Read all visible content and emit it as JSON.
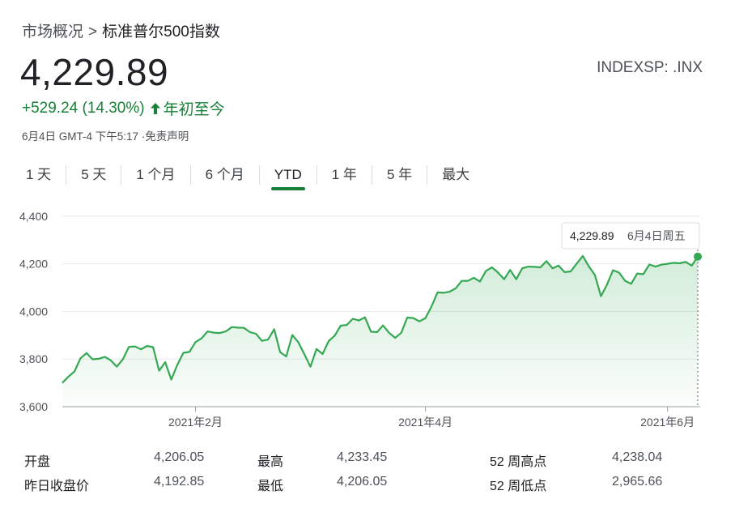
{
  "breadcrumb": {
    "parent": "市场概况",
    "separator": ">",
    "current": "标准普尔500指数"
  },
  "price": "4,229.89",
  "ticker": "INDEXSP: .INX",
  "change": {
    "text": "+529.24 (14.30%)",
    "period": "年初至今",
    "color": "#188038",
    "direction": "up",
    "icon": "arrow-up-icon"
  },
  "timestamp": "6月4日 GMT-4 下午5:17 ·免责声明",
  "tabs": [
    {
      "label": "1 天",
      "active": false
    },
    {
      "label": "5 天",
      "active": false
    },
    {
      "label": "1 个月",
      "active": false
    },
    {
      "label": "6 个月",
      "active": false
    },
    {
      "label": "YTD",
      "active": true
    },
    {
      "label": "1 年",
      "active": false
    },
    {
      "label": "5 年",
      "active": false
    },
    {
      "label": "最大",
      "active": false
    }
  ],
  "chart_data": {
    "type": "area",
    "y_ticks": [
      "4,400",
      "4,200",
      "4,000",
      "3,800",
      "3,600"
    ],
    "y_tick_values": [
      4400,
      4200,
      4000,
      3800,
      3600
    ],
    "ylim": [
      3600,
      4440
    ],
    "x_ticks": [
      {
        "label": "2021年2月",
        "index": 22
      },
      {
        "label": "2021年4月",
        "index": 60
      },
      {
        "label": "2021年6月",
        "index": 100
      }
    ],
    "line_color": "#34a853",
    "grid": true,
    "tooltip": {
      "value": "4,229.89",
      "date": "6月4日周五"
    },
    "series": [
      {
        "values": [
          3700,
          3726,
          3748,
          3803,
          3825,
          3799,
          3801,
          3809,
          3795,
          3768,
          3799,
          3851,
          3853,
          3841,
          3855,
          3850,
          3751,
          3787,
          3714,
          3775,
          3826,
          3830,
          3871,
          3887,
          3916,
          3911,
          3909,
          3916,
          3934,
          3932,
          3931,
          3913,
          3906,
          3876,
          3882,
          3925,
          3829,
          3811,
          3901,
          3870,
          3820,
          3768,
          3842,
          3821,
          3875,
          3898,
          3940,
          3943,
          3969,
          3962,
          3975,
          3915,
          3913,
          3941,
          3910,
          3889,
          3910,
          3974,
          3972,
          3958,
          3972,
          4020,
          4080,
          4078,
          4083,
          4097,
          4128,
          4128,
          4141,
          4125,
          4170,
          4185,
          4163,
          4135,
          4174,
          4135,
          4181,
          4188,
          4187,
          4185,
          4211,
          4181,
          4192,
          4165,
          4168,
          4201,
          4233,
          4189,
          4153,
          4064,
          4113,
          4173,
          4163,
          4128,
          4116,
          4159,
          4156,
          4197,
          4188,
          4196,
          4200,
          4204,
          4202,
          4208,
          4192,
          4230
        ]
      }
    ]
  },
  "stats": {
    "rows": [
      [
        {
          "label": "开盘",
          "value": "4,206.05"
        },
        {
          "label": "最高",
          "value": "4,233.45"
        },
        {
          "label": "52 周高点",
          "value": "4,238.04"
        }
      ],
      [
        {
          "label": "昨日收盘价",
          "value": "4,192.85"
        },
        {
          "label": "最低",
          "value": "4,206.05"
        },
        {
          "label": "52 周低点",
          "value": "2,965.66"
        }
      ]
    ]
  }
}
